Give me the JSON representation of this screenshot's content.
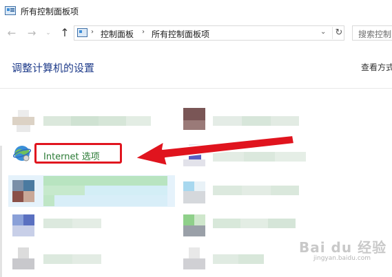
{
  "window": {
    "title": "所有控制面板项"
  },
  "nav": {
    "back_glyph": "←",
    "forward_glyph": "→",
    "dropdown_glyph": "⌄",
    "up_glyph": "↑",
    "breadcrumbs": [
      "控制面板",
      "所有控制面板项"
    ],
    "separator": "›",
    "refresh_glyph": "↻",
    "chevron_glyph": "⌄"
  },
  "search": {
    "placeholder": "搜索控制"
  },
  "header": {
    "title": "调整计算机的设置",
    "view_by": "查看方式"
  },
  "highlighted_item": {
    "label": "Internet 选项",
    "icon": "internet-options-globe-icon"
  },
  "annotation": {
    "arrow_color": "#e0141e",
    "box_color": "#e0141e"
  },
  "watermark": {
    "logo": "Bai du 经验",
    "url": "jingyan.baidu.com"
  },
  "colors": {
    "heading": "#1e3b8a",
    "item_label": "#2a7a34",
    "highlight": "#e0141e"
  }
}
